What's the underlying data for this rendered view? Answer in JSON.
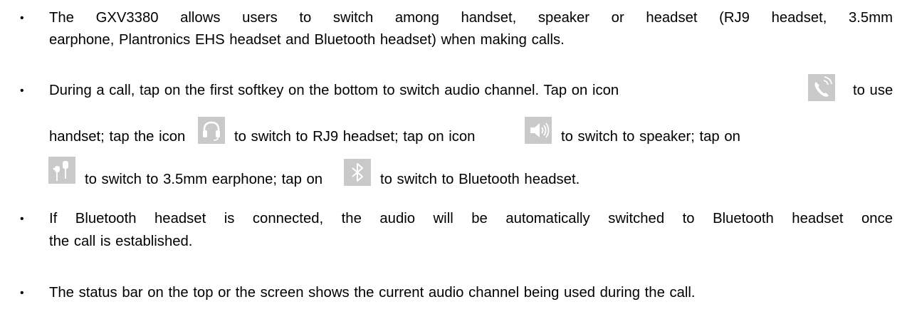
{
  "bullets": [
    {
      "lines": [
        "The GXV3380 allows users to switch among handset, speaker or headset (RJ9 headset, 3.5mm",
        "earphone, Plantronics EHS headset and Bluetooth headset) when making calls."
      ]
    },
    {
      "segments": {
        "l1_a": "During a call, tap on the first softkey on the bottom to switch audio channel. Tap on icon",
        "l1_b": "to use",
        "l2_a": "handset; tap the icon",
        "l2_b": "to switch to RJ9 headset; tap on icon",
        "l2_c": "to switch to speaker; tap on",
        "l3_a": "to switch to 3.5mm earphone; tap on",
        "l3_b": "to switch to Bluetooth headset."
      },
      "icons": [
        "handset-icon",
        "headset-icon",
        "speaker-icon",
        "earphone-icon",
        "bluetooth-icon"
      ]
    },
    {
      "lines": [
        "If Bluetooth headset is connected, the audio will be automatically switched to Bluetooth headset once",
        "the call is established."
      ]
    },
    {
      "lines": [
        "The status bar on the top or the screen shows the current audio channel being used during the call."
      ]
    }
  ],
  "bullet_char": "•",
  "colors": {
    "icon_bg": "#c9c9c9",
    "icon_fg": "#ffffff",
    "text": "#000000"
  }
}
